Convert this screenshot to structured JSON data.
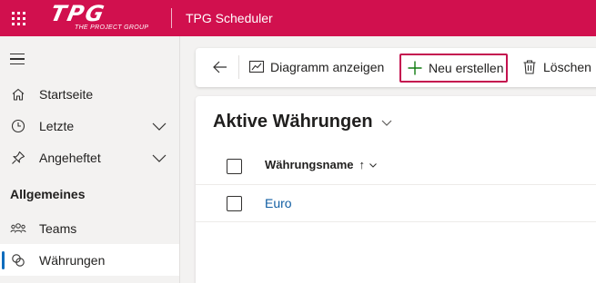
{
  "header": {
    "logo_text": "TPG",
    "logo_subtitle": "THE PROJECT GROUP",
    "app_title": "TPG Scheduler",
    "background_color": "#d1104e"
  },
  "sidebar": {
    "items": [
      {
        "label": "Startseite",
        "icon": "home-icon",
        "expandable": false
      },
      {
        "label": "Letzte",
        "icon": "clock-icon",
        "expandable": true
      },
      {
        "label": "Angeheftet",
        "icon": "pin-icon",
        "expandable": true
      }
    ],
    "section_title": "Allgemeines",
    "section_items": [
      {
        "label": "Teams",
        "icon": "people-icon",
        "active": false
      },
      {
        "label": "Währungen",
        "icon": "coins-icon",
        "active": true
      }
    ],
    "active_color": "#0f6cbd"
  },
  "commandbar": {
    "back_icon": "back-arrow-icon",
    "chart_label": "Diagramm anzeigen",
    "new_label": "Neu erstellen",
    "delete_label": "Löschen",
    "highlight_color": "#c4124f"
  },
  "view": {
    "title": "Aktive Währungen",
    "columns": [
      {
        "label": "Währungsname",
        "sort": "↑"
      }
    ],
    "rows": [
      {
        "name": "Euro"
      }
    ],
    "link_color": "#115ea3"
  }
}
